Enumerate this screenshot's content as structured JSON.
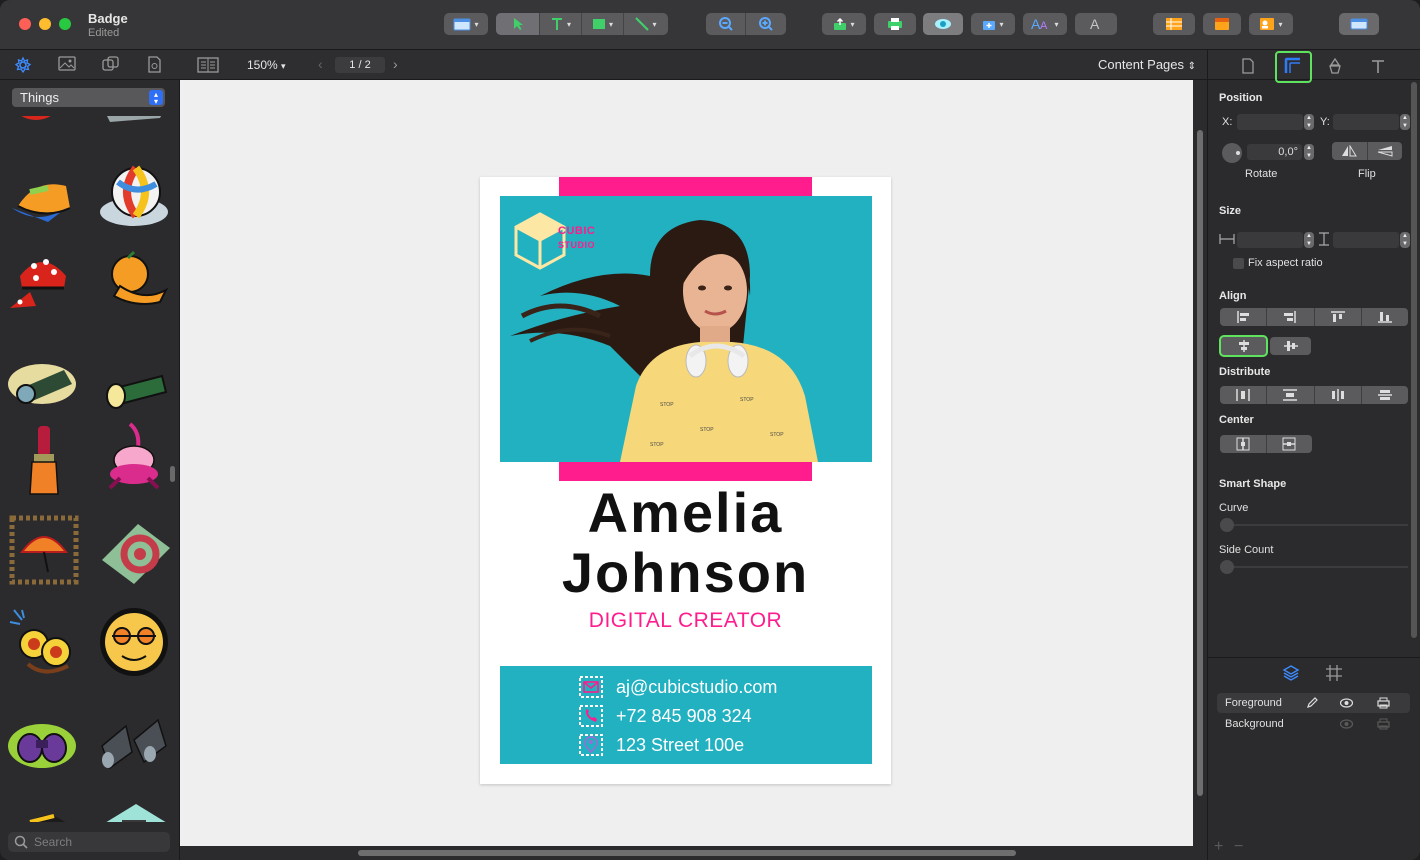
{
  "window": {
    "title": "Badge",
    "subtitle": "Edited"
  },
  "subbar": {
    "zoom": "150%",
    "page_indicator": "1 / 2",
    "pages_menu": "Content Pages"
  },
  "library": {
    "category": "Things",
    "search_placeholder": "Search"
  },
  "badge": {
    "logo_line1": "CUBIC",
    "logo_line2": "STUDIO",
    "first_name": "Amelia",
    "last_name": "Johnson",
    "role": "DIGITAL CREATOR",
    "email": "aj@cubicstudio.com",
    "phone": "+72 845 908 324",
    "address": "123 Street 100e",
    "colors": {
      "accent": "#ff1c8d",
      "teal": "#22b1c1"
    }
  },
  "inspector": {
    "position_header": "Position",
    "x_label": "X:",
    "y_label": "Y:",
    "rotate_value": "0,0°",
    "rotate_label": "Rotate",
    "flip_label": "Flip",
    "size_header": "Size",
    "fix_aspect": "Fix aspect ratio",
    "align_header": "Align",
    "distribute_header": "Distribute",
    "center_header": "Center",
    "smart_shape_header": "Smart Shape",
    "curve_label": "Curve",
    "side_count_label": "Side Count"
  },
  "layers": [
    {
      "name": "Foreground"
    },
    {
      "name": "Background"
    }
  ]
}
